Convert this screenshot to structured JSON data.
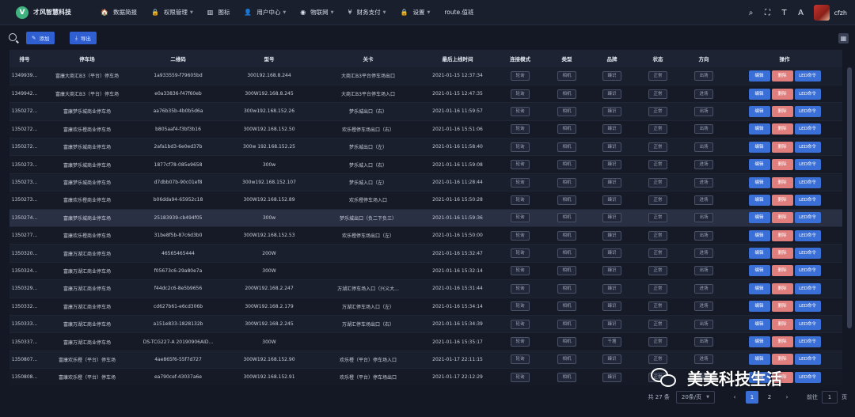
{
  "brand": {
    "logo_letter": "V",
    "name": "才风智慧科技"
  },
  "nav": [
    {
      "icon": "home-icon",
      "glyph": "🏠",
      "label": "数据简报",
      "caret": false
    },
    {
      "icon": "lock-icon",
      "glyph": "🔒",
      "label": "权限管理",
      "caret": true
    },
    {
      "icon": "chart-icon",
      "glyph": "▥",
      "label": "图标",
      "caret": false
    },
    {
      "icon": "user-icon",
      "glyph": "👤",
      "label": "用户中心",
      "caret": true
    },
    {
      "icon": "network-icon",
      "glyph": "◉",
      "label": "物联网",
      "caret": true
    },
    {
      "icon": "yen-icon",
      "glyph": "¥",
      "label": "财务支付",
      "caret": true
    },
    {
      "icon": "lock-icon",
      "glyph": "🔒",
      "label": "设置",
      "caret": true
    },
    {
      "icon": "none",
      "glyph": "",
      "label": "route.值班",
      "caret": false
    }
  ],
  "user": {
    "name": "cfzh"
  },
  "toolbar": {
    "add_label": "添加",
    "export_label": "导出"
  },
  "table": {
    "headers": [
      "排号",
      "停车场",
      "二维码",
      "型号",
      "关卡",
      "最后上线时间",
      "连接模式",
      "类型",
      "品牌",
      "状态",
      "方向",
      "操作"
    ],
    "rows": [
      [
        "1349939...",
        "富康大商汇B3（平台）停车场",
        "1a933559-f79605bd",
        "300192.168.8.244",
        "大商汇B3平台停车场出口",
        "2021-01-15 12:37:34",
        "轮询",
        "相机",
        "臻识",
        "正常",
        "出场"
      ],
      [
        "1349942...",
        "富康大商汇B3（平台）停车场",
        "e0a33836-f47f60eb",
        "300W192.168.8.245",
        "大商汇B3平台停车场入口",
        "2021-01-15 12:47:35",
        "轮询",
        "相机",
        "臻识",
        "正常",
        "进场"
      ],
      [
        "1350272...",
        "富康梦乐城商业停车场",
        "aa76b35b-4b0b5d6a",
        "300w192.168.152.26",
        "梦乐城出口（右）",
        "2021-01-16 11:59:57",
        "轮询",
        "相机",
        "臻识",
        "正常",
        "出场"
      ],
      [
        "1350272...",
        "富康欢乐橙商业停车场",
        "b805aaf4-f3bf3b16",
        "300W192.168.152.50",
        "欢乐橙停车场出口（右）",
        "2021-01-16 15:51:06",
        "轮询",
        "相机",
        "臻识",
        "正常",
        "出场"
      ],
      [
        "1350272...",
        "富康梦乐城商业停车场",
        "2afa1bd3-6e0ed37b",
        "300w 192.168.152.25",
        "梦乐城出口（左）",
        "2021-01-16 11:58:40",
        "轮询",
        "相机",
        "臻识",
        "正常",
        "出场"
      ],
      [
        "1350273...",
        "富康梦乐城商业停车场",
        "1877cf78-085e9658",
        "300w",
        "梦乐城入口（右）",
        "2021-01-16 11:59:08",
        "轮询",
        "相机",
        "臻识",
        "正常",
        "进场"
      ],
      [
        "1350273...",
        "富康梦乐城商业停车场",
        "d7dbb07b-90c01ef8",
        "300w192.168.152.107",
        "梦乐城入口（左）",
        "2021-01-16 11:28:44",
        "轮询",
        "相机",
        "臻识",
        "正常",
        "进场"
      ],
      [
        "1350273...",
        "富康欢乐橙商业停车场",
        "b06dda94-65952c18",
        "300W192.168.152.89",
        "欢乐橙停车场入口",
        "2021-01-16 15:50:28",
        "轮询",
        "相机",
        "臻识",
        "正常",
        "进场"
      ],
      [
        "1350274...",
        "富康梦乐城商业停车场",
        "25183939-cb494f05",
        "300w",
        "梦乐城出口（负二下负三）",
        "2021-01-16 11:59:36",
        "轮询",
        "相机",
        "臻识",
        "正常",
        "出场"
      ],
      [
        "1350277...",
        "富康欢乐橙商业停车场",
        "31be8f5b-87c6d3b0",
        "300W192.168.152.53",
        "欢乐橙停车场出口（左）",
        "2021-01-16 15:50:00",
        "轮询",
        "相机",
        "臻识",
        "正常",
        "出场"
      ],
      [
        "1350320...",
        "富康万湖汇商业停车场",
        "46565465444",
        "200W",
        "",
        "2021-01-16 15:32:47",
        "轮询",
        "相机",
        "臻识",
        "正常",
        "进场"
      ],
      [
        "1350324...",
        "富康万湖汇商业停车场",
        "f05673c6-29a80e7a",
        "300W",
        "",
        "2021-01-16 15:32:14",
        "轮询",
        "相机",
        "臻识",
        "正常",
        "出场"
      ],
      [
        "1350329...",
        "富康万湖汇商业停车场",
        "f44dc2c6-8e5b9656",
        "200W192.168.2.247",
        "万湖汇停车场入口（兴义大...",
        "2021-01-16 15:31:44",
        "轮询",
        "相机",
        "臻识",
        "正常",
        "进场"
      ],
      [
        "1350332...",
        "富康万湖汇商业停车场",
        "cd627b61-e6cd306b",
        "300W192.168.2.179",
        "万湖汇停车场入口（左）",
        "2021-01-16 15:34:14",
        "轮询",
        "相机",
        "臻识",
        "正常",
        "进场"
      ],
      [
        "1350333...",
        "富康万湖汇商业停车场",
        "a151e833-1828132b",
        "300W192.168.2.245",
        "万湖汇停车场出口（右）",
        "2021-01-16 15:34:39",
        "轮询",
        "相机",
        "臻识",
        "正常",
        "出场"
      ],
      [
        "1350337...",
        "富康万湖汇商业停车场",
        "DS-TCG227-A 20190906AID...",
        "300W",
        "",
        "2021-01-16 15:35:17",
        "轮询",
        "相机",
        "千壇",
        "正常",
        "出场"
      ],
      [
        "1350807...",
        "富康欢乐橙（平台）停车场",
        "4ae865f6-55f7d727",
        "300W192.168.152.90",
        "欢乐橙（平台）停车场入口",
        "2021-01-17 22:11:15",
        "轮询",
        "相机",
        "臻识",
        "正常",
        "进场"
      ],
      [
        "1350808...",
        "富康欢乐橙（平台）停车场",
        "ea790cef-43037a6e",
        "300W192.168.152.91",
        "欢乐橙（平台）停车场出口",
        "2021-01-17 22:12:29",
        "轮询",
        "相机",
        "臻识",
        "正常",
        "出场"
      ]
    ],
    "highlighted_row": 8,
    "actions": {
      "edit": "编辑",
      "delete": "删除",
      "led": "LED命令"
    }
  },
  "pagination": {
    "total_text": "共 27 条",
    "page_size": "20条/页",
    "pages": [
      "1",
      "2"
    ],
    "current": "1",
    "goto_label": "前往",
    "goto_value": "1",
    "page_unit": "页"
  },
  "watermark": {
    "text": "美美科技生活"
  },
  "colors": {
    "primary": "#3a6fd8",
    "danger": "#e07d7d",
    "background": "#141824"
  }
}
